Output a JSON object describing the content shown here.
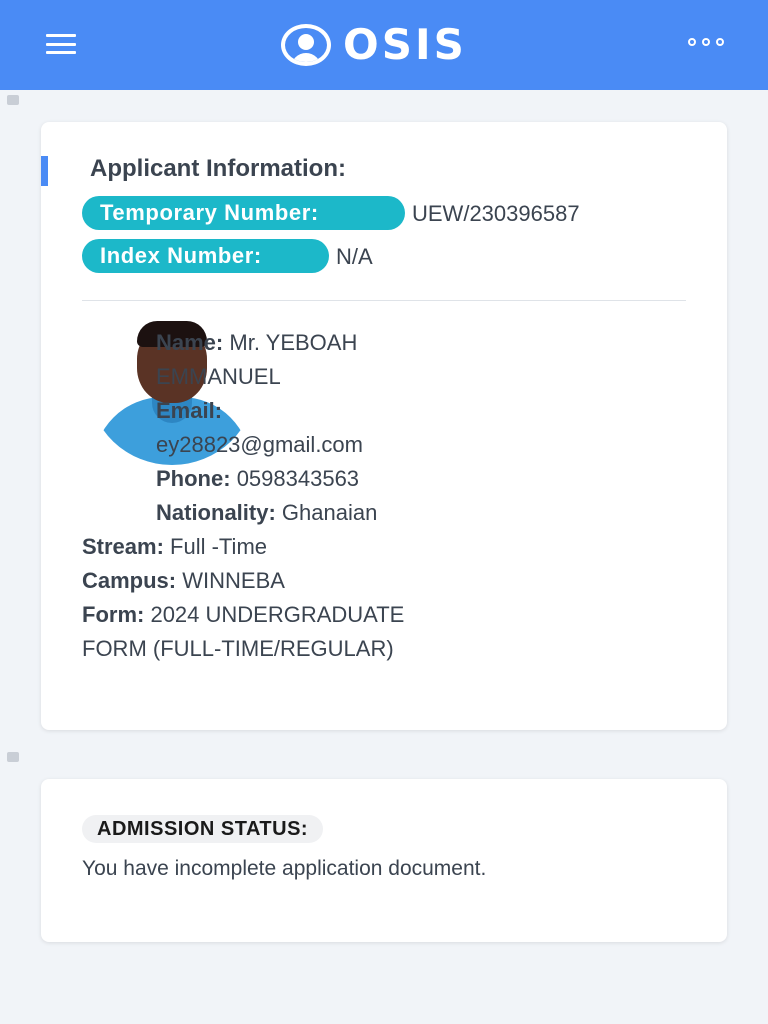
{
  "header": {
    "brand": "OSIS",
    "brand_icon": "user-circle-icon",
    "menu_icon": "hamburger-icon",
    "more_icon": "more-dots-icon",
    "color": "#4a8bf5"
  },
  "applicant": {
    "section_title": "Applicant Information:",
    "temporary_number_label": "Temporary Number:",
    "temporary_number_value": "UEW/230396587",
    "index_number_label": "Index Number:",
    "index_number_value": "N/A",
    "photo_icon": "applicant-photo",
    "name_label": "Name:",
    "name_value": "Mr. YEBOAH EMMANUEL",
    "email_label": "Email:",
    "email_value": "ey28823@gmail.com",
    "phone_label": "Phone:",
    "phone_value": "0598343563",
    "nationality_label": "Nationality:",
    "nationality_value": "Ghanaian",
    "stream_label": "Stream:",
    "stream_value": "Full -Time",
    "campus_label": "Campus:",
    "campus_value": "WINNEBA",
    "form_label": "Form:",
    "form_value": "2024 UNDERGRADUATE FORM (FULL-TIME/REGULAR)"
  },
  "admission": {
    "status_label": "ADMISSION STATUS:",
    "status_message": "You have incomplete application document."
  },
  "colors": {
    "accent": "#4a8bf5",
    "pill": "#1cb8c9"
  }
}
